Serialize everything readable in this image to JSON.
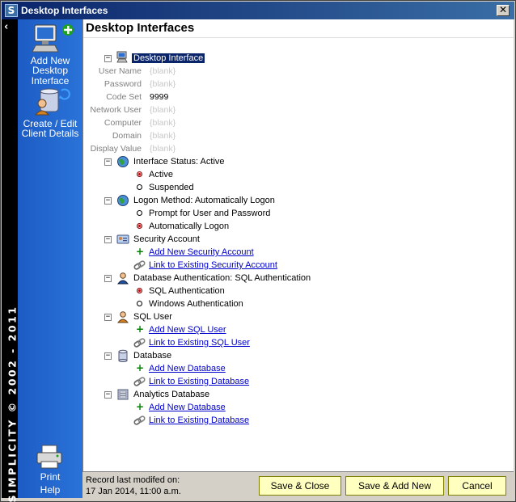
{
  "window": {
    "title": "Desktop Interfaces",
    "app_icon_letter": "S",
    "close_glyph": "✕"
  },
  "strip": {
    "copyright": "SIMPLICITY © 2002 - 2011",
    "collapse_glyph": "‹"
  },
  "sidebar": {
    "add_new": "Add New Desktop Interface",
    "add_new_lines": [
      "Add New",
      "Desktop",
      "Interface"
    ],
    "create_edit_lines": [
      "Create / Edit",
      "Client Details"
    ],
    "print": "Print",
    "help": "Help"
  },
  "main": {
    "page_title": "Desktop Interfaces",
    "root_node": "Desktop Interface",
    "fields": [
      {
        "label": "User Name",
        "value": "{blank}"
      },
      {
        "label": "Password",
        "value": "{blank}"
      },
      {
        "label": "Code Set",
        "value": "9999"
      },
      {
        "label": "Network User",
        "value": "{blank}"
      },
      {
        "label": "Computer",
        "value": "{blank}"
      },
      {
        "label": "Domain",
        "value": "{blank}"
      },
      {
        "label": "Display Value",
        "value": "{blank}"
      }
    ],
    "interface_status": {
      "label": "Interface Status:  Active",
      "options": [
        {
          "label": "Active",
          "selected": true
        },
        {
          "label": "Suspended",
          "selected": false
        }
      ]
    },
    "logon_method": {
      "label": "Logon Method:  Automatically Logon",
      "options": [
        {
          "label": "Prompt for User and Password",
          "selected": false
        },
        {
          "label": "Automatically Logon",
          "selected": true
        }
      ]
    },
    "security_account": {
      "label": "Security Account",
      "add_link": "Add New Security Account",
      "existing_link": "Link to Existing Security Account"
    },
    "db_auth": {
      "label": "Database Authentication:  SQL Authentication",
      "options": [
        {
          "label": "SQL Authentication",
          "selected": true
        },
        {
          "label": "Windows Authentication",
          "selected": false
        }
      ]
    },
    "sql_user": {
      "label": "SQL User",
      "add_link": "Add New SQL User",
      "existing_link": "Link to Existing SQL User"
    },
    "database": {
      "label": "Database",
      "add_link": "Add New Database",
      "existing_link": "Link to Existing Database"
    },
    "analytics_database": {
      "label": "Analytics Database",
      "add_link": "Add New Database",
      "existing_link": "Link to Existing Database"
    }
  },
  "footer": {
    "record_line1": "Record last modifed on:",
    "record_line2": "17 Jan 2014, 11:00 a.m.",
    "save_close": "Save & Close",
    "save_add_new": "Save & Add New",
    "cancel": "Cancel"
  },
  "colors": {
    "sidebar": "#2266cc",
    "title_bar": "#0a246a",
    "link": "#0000cc",
    "button_bg": "#ffffc0"
  }
}
